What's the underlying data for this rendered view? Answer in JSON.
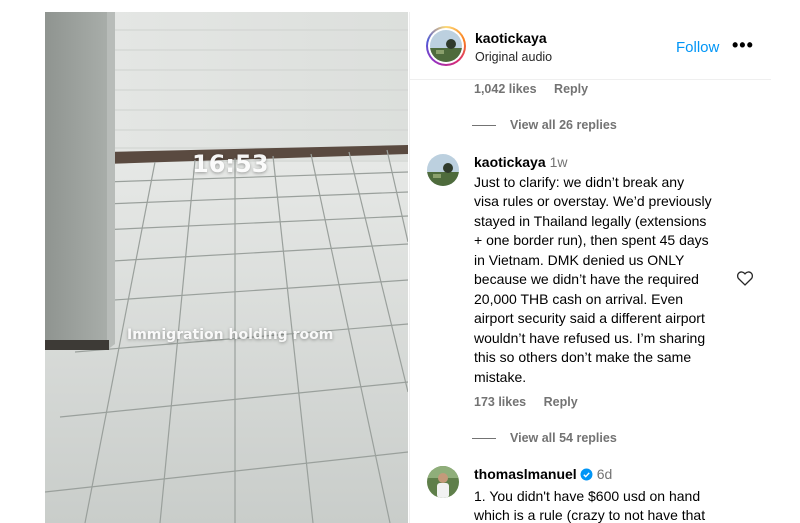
{
  "media": {
    "overlay_time": "16:53",
    "overlay_caption": "Immigration holding room"
  },
  "header": {
    "username": "kaotickaya",
    "audio": "Original audio",
    "follow": "Follow",
    "more": "•••"
  },
  "top_meta": {
    "likes": "1,042 likes",
    "reply": "Reply"
  },
  "replies_1": "View all 26 replies",
  "comment_1": {
    "username": "kaotickaya",
    "time": "1w",
    "lines": [
      "Just to clarify: we didn’t break any",
      "visa rules or overstay. We’d previously",
      "stayed in Thailand legally (extensions",
      "+ one border run), then spent 45 days",
      "in Vietnam. DMK denied us ONLY",
      "because we didn’t have the required",
      "20,000 THB cash on arrival. Even",
      "airport security said a different airport",
      "wouldn’t have refused us. I’m sharing",
      "this so others don’t make the same",
      "mistake."
    ],
    "likes": "173 likes",
    "reply": "Reply"
  },
  "replies_2": "View all 54 replies",
  "comment_2": {
    "username": "thomaslmanuel",
    "time": "6d",
    "lines": [
      "1. You didn't have $600 usd on hand",
      "which is a rule (crazy to not have that"
    ]
  },
  "colors": {
    "link": "#0095f6",
    "muted": "#737373",
    "verified": "#0095f6"
  }
}
